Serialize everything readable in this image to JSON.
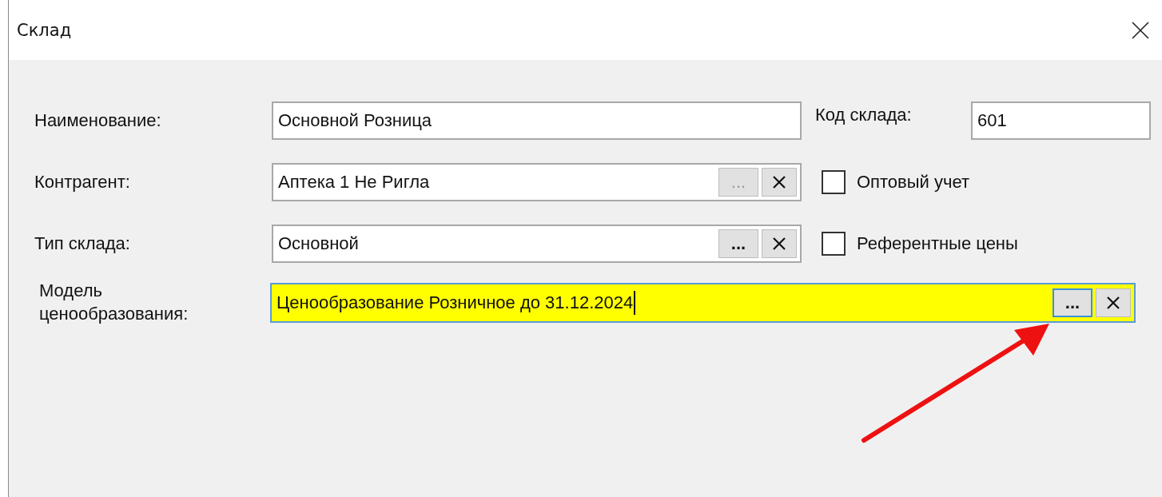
{
  "window": {
    "title": "Склад",
    "closable": true
  },
  "fields": [
    {
      "label": "Наименование:",
      "value": "Основной Розница",
      "kind": "text",
      "highlighted": false,
      "focused": false
    },
    {
      "label": "Контрагент:",
      "value": "Аптека 1 Не Ригла",
      "kind": "lookup",
      "browse": "...",
      "browse_disabled": true,
      "highlighted": false,
      "focused": false
    },
    {
      "label": "Тип склада:",
      "value": "Основной",
      "kind": "lookup",
      "browse": "...",
      "browse_disabled": false,
      "highlighted": false,
      "focused": false
    },
    {
      "label": "Модель\nценообразования:",
      "value": "Ценообразование Розничное до 31.12.2024",
      "kind": "lookup",
      "browse": "...",
      "browse_disabled": false,
      "highlighted": true,
      "focused": true
    }
  ],
  "warehouse_code": {
    "label": "Код склада:",
    "value": "601"
  },
  "checkboxes": [
    {
      "label": "Оптовый учет",
      "checked": false
    },
    {
      "label": "Референтные цены",
      "checked": false
    }
  ]
}
